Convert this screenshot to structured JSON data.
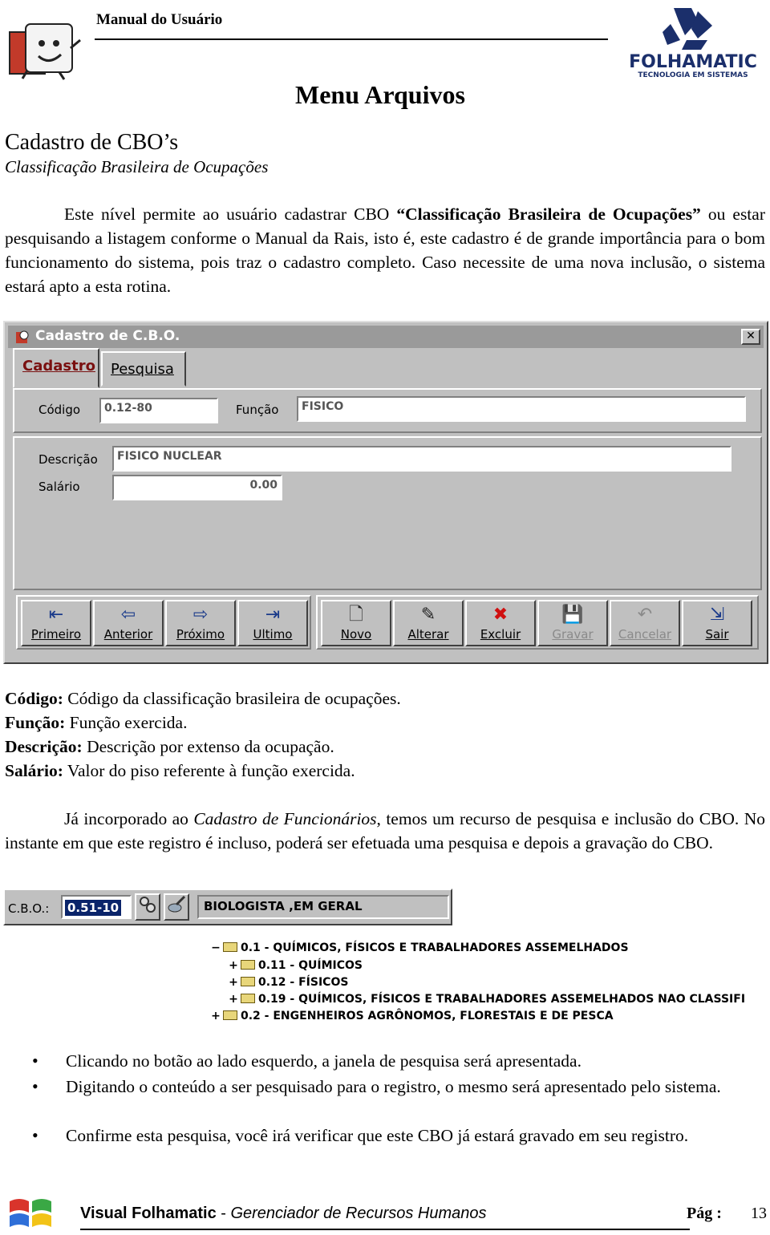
{
  "header": {
    "title": "Manual do Usuário",
    "logo_text": "FOLHAMATIC",
    "logo_sub": "TECNOLOGIA EM SISTEMAS"
  },
  "section_title": "Menu Arquivos",
  "heading": "Cadastro de CBO’s",
  "subheading": "Classificação Brasileira de Ocupações",
  "intro": {
    "p1_a": "Este nível permite ao usuário cadastrar CBO ",
    "p1_bold": "“Classificação Brasileira de Ocupações”",
    "p1_b": " ou estar pesquisando a listagem conforme o Manual da Rais, isto é, este cadastro é de grande importância para o bom funcionamento do sistema, pois traz o cadastro completo. Caso necessite de uma nova inclusão, o sistema estará apto a esta rotina."
  },
  "window": {
    "title": "Cadastro de C.B.O.",
    "close_glyph": "✕",
    "tabs": [
      "Cadastro",
      "Pesquisa"
    ],
    "labels": {
      "codigo": "Código",
      "funcao": "Função",
      "descricao": "Descrição",
      "salario": "Salário"
    },
    "values": {
      "codigo": "0.12-80",
      "funcao": "FISICO",
      "descricao": "FISICO NUCLEAR",
      "salario": "0.00"
    },
    "nav_buttons": [
      {
        "label": "Primeiro",
        "glyph": "⇤"
      },
      {
        "label": "Anterior",
        "glyph": "⇦"
      },
      {
        "label": "Próximo",
        "glyph": "⇨"
      },
      {
        "label": "Ultimo",
        "glyph": "⇥"
      }
    ],
    "action_buttons": [
      {
        "label": "Novo",
        "glyph": "🗋"
      },
      {
        "label": "Alterar",
        "glyph": "✎"
      },
      {
        "label": "Excluir",
        "glyph": "✖"
      },
      {
        "label": "Gravar",
        "glyph": "💾"
      },
      {
        "label": "Cancelar",
        "glyph": "↶"
      },
      {
        "label": "Sair",
        "glyph": "⇲"
      }
    ]
  },
  "definitions": [
    {
      "term": "Código:",
      "text": " Código da classificação brasileira de ocupações."
    },
    {
      "term": "Função:",
      "text": " Função exercida."
    },
    {
      "term": "Descrição:",
      "text": " Descrição por extenso da ocupação."
    },
    {
      "term": "Salário:",
      "text": " Valor do piso referente à função exercida."
    }
  ],
  "para2": {
    "a": "Já incorporado ao ",
    "italic": "Cadastro de Funcionários",
    "b": ", temos um recurso de pesquisa e inclusão do CBO. No instante em que este registro é incluso, poderá ser efetuada uma pesquisa e depois a gravação do CBO."
  },
  "cbo_strip": {
    "label": "C.B.O.:",
    "code": "0.51-10",
    "description": "BIOLOGISTA ,EM GERAL"
  },
  "tree": [
    {
      "toggle": "−",
      "text": "0.1 - QUÍMICOS, FÍSICOS E TRABALHADORES ASSEMELHADOS"
    },
    {
      "toggle": "+",
      "text": "0.11 - QUÍMICOS"
    },
    {
      "toggle": "+",
      "text": "0.12 - FÍSICOS"
    },
    {
      "toggle": "+",
      "text": "0.19 - QUÍMICOS, FÍSICOS E TRABALHADORES ASSEMELHADOS NAO CLASSIFI"
    },
    {
      "toggle": "+",
      "text": "0.2 - ENGENHEIROS AGRÔNOMOS, FLORESTAIS E DE PESCA"
    }
  ],
  "bullets": [
    "Clicando no botão ao lado esquerdo, a janela de pesquisa será apresentada.",
    "Digitando o conteúdo a ser pesquisado para o registro, o mesmo será apresentado pelo sistema.",
    "Confirme esta pesquisa, você irá verificar que este CBO já estará gravado em seu registro."
  ],
  "footer": {
    "brand": "Visual Folhamatic",
    "sep": " - ",
    "subtitle": "Gerenciador de Recursos Humanos",
    "page_label": "Pág :",
    "page_number": "13"
  }
}
